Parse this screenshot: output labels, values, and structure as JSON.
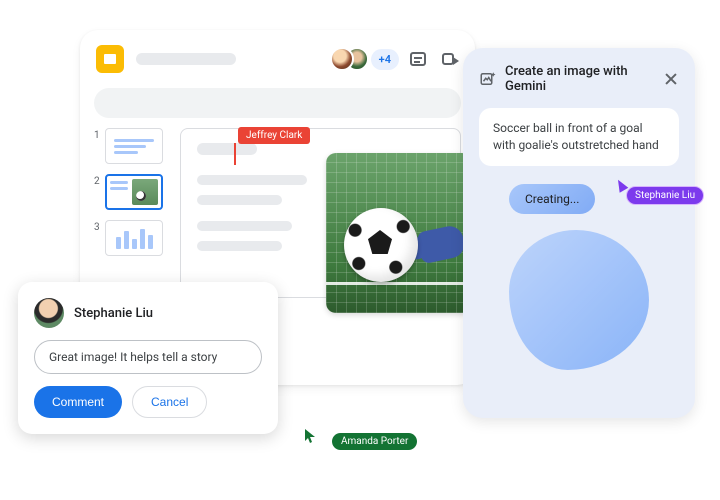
{
  "header": {
    "plus_count": "+4"
  },
  "thumbs": {
    "nums": [
      "1",
      "2",
      "3"
    ]
  },
  "cursor_labels": {
    "jeffrey": "Jeffrey Clark",
    "stephanie": "Stephanie Liu",
    "amanda": "Amanda Porter"
  },
  "gemini": {
    "title": "Create an image with Gemini",
    "prompt": "Soccer ball in front of a goal with goalie's outstretched hand",
    "creating": "Creating..."
  },
  "comment": {
    "author": "Stephanie Liu",
    "text": "Great image! It helps tell a story",
    "submit": "Comment",
    "cancel": "Cancel"
  }
}
